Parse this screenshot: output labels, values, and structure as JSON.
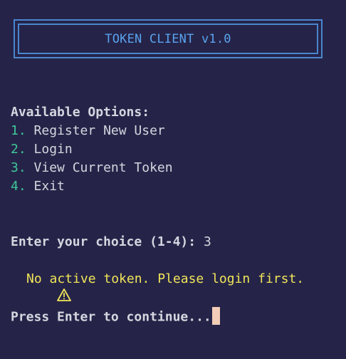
{
  "banner": {
    "title": "TOKEN CLIENT v1.0"
  },
  "menu": {
    "heading": "Available Options:",
    "options": [
      {
        "number": "1.",
        "label": "Register New User"
      },
      {
        "number": "2.",
        "label": "Login"
      },
      {
        "number": "3.",
        "label": "View Current Token"
      },
      {
        "number": "4.",
        "label": "Exit"
      }
    ]
  },
  "prompt": {
    "label": "Enter your choice (1-4):",
    "value": "3"
  },
  "message": {
    "icon": "warning-icon",
    "text": "No active token. Please login first."
  },
  "continue_prompt": {
    "text": "Press Enter to continue..."
  },
  "colors": {
    "background": "#252448",
    "banner_border": "#4a86ce",
    "banner_text": "#5aa2ee",
    "option_number": "#3fc89a",
    "warning_text": "#f1e45a",
    "cursor": "#f3cdb8"
  }
}
